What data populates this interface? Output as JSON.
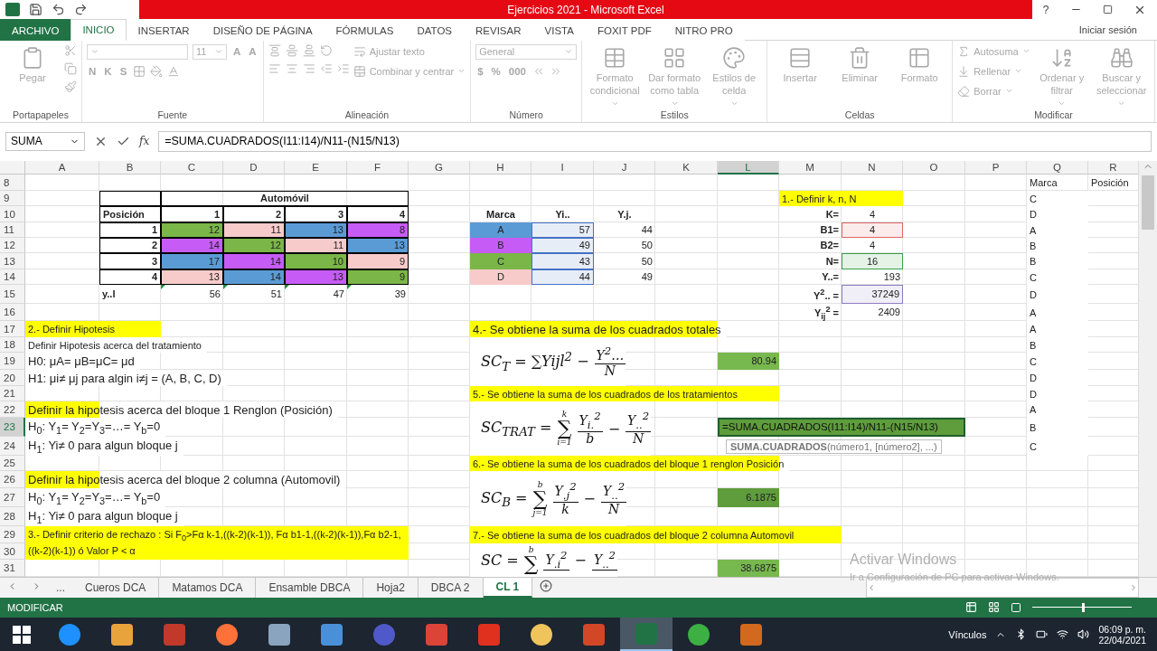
{
  "title_bar": {
    "title": "Ejercicios 2021 -  Microsoft Excel",
    "help": "?"
  },
  "tabs": [
    {
      "label": "ARCHIVO",
      "kind": "file",
      "selected": false
    },
    {
      "label": "INICIO",
      "kind": "tab",
      "selected": true
    },
    {
      "label": "INSERTAR",
      "kind": "tab",
      "selected": false
    },
    {
      "label": "DISEÑO DE PÁGINA",
      "kind": "tab",
      "selected": false
    },
    {
      "label": "FÓRMULAS",
      "kind": "tab",
      "selected": false
    },
    {
      "label": "DATOS",
      "kind": "tab",
      "selected": false
    },
    {
      "label": "REVISAR",
      "kind": "tab",
      "selected": false
    },
    {
      "label": "VISTA",
      "kind": "tab",
      "selected": false
    },
    {
      "label": "FOXIT PDF",
      "kind": "tab",
      "selected": false
    },
    {
      "label": "NITRO PRO",
      "kind": "tab",
      "selected": false
    }
  ],
  "sign_in": "Iniciar sesión",
  "ribbon": {
    "disabled": true,
    "groups": [
      {
        "label": "Portapapeles",
        "columns": [
          [
            {
              "kind": "large",
              "label": "Pegar",
              "menu": false
            }
          ],
          [
            {
              "kind": "icon"
            },
            {
              "kind": "icon"
            },
            {
              "kind": "icon"
            }
          ]
        ]
      },
      {
        "label": "Fuente",
        "columns": [
          [
            {
              "kind": "line",
              "items": [
                {
                  "kind": "wide_field"
                },
                {
                  "kind": "narrow_field",
                  "value": "11"
                },
                {
                  "kind": "glyphs",
                  "glyphs": [
                    "A",
                    "A"
                  ]
                }
              ]
            },
            {
              "kind": "line",
              "items": [
                {
                  "kind": "glyphs",
                  "glyphs": [
                    "N",
                    "K",
                    "S"
                  ]
                },
                {
                  "kind": "icon"
                },
                {
                  "kind": "icon"
                },
                {
                  "kind": "icon"
                }
              ]
            }
          ]
        ]
      },
      {
        "label": "Alineación",
        "columns": [
          [
            {
              "kind": "line",
              "items": [
                {
                  "kind": "icon"
                },
                {
                  "kind": "icon"
                },
                {
                  "kind": "icon"
                },
                {
                  "kind": "icon"
                }
              ]
            },
            {
              "kind": "line",
              "items": [
                {
                  "kind": "icon"
                },
                {
                  "kind": "icon"
                },
                {
                  "kind": "icon"
                },
                {
                  "kind": "icon"
                },
                {
                  "kind": "icon"
                }
              ]
            }
          ],
          [
            {
              "kind": "small",
              "label": "Ajustar texto",
              "menu": false
            },
            {
              "kind": "small",
              "label": "Combinar y centrar",
              "menu": true
            }
          ]
        ]
      },
      {
        "label": "Número",
        "columns": [
          [
            {
              "kind": "wide_field",
              "value": "General"
            },
            {
              "kind": "line",
              "items": [
                {
                  "kind": "glyphs",
                  "glyphs": [
                    "$",
                    "%",
                    "000"
                  ]
                },
                {
                  "kind": "icon"
                },
                {
                  "kind": "icon"
                }
              ]
            }
          ]
        ]
      },
      {
        "label": "Estilos",
        "columns": [
          [
            {
              "kind": "large",
              "label": "Formato condicional",
              "menu": true
            }
          ],
          [
            {
              "kind": "large",
              "label": "Dar formato como tabla",
              "menu": true
            }
          ],
          [
            {
              "kind": "large",
              "label": "Estilos de celda",
              "menu": true
            }
          ]
        ]
      },
      {
        "label": "Celdas",
        "columns": [
          [
            {
              "kind": "large",
              "label": "Insertar",
              "menu": false
            }
          ],
          [
            {
              "kind": "large",
              "label": "Eliminar",
              "menu": false
            }
          ],
          [
            {
              "kind": "large",
              "label": "Formato",
              "menu": false
            }
          ]
        ]
      },
      {
        "label": "Modificar",
        "columns": [
          [
            {
              "kind": "small",
              "label": "Autosuma",
              "menu": true
            },
            {
              "kind": "small",
              "label": "Rellenar",
              "menu": true
            },
            {
              "kind": "small",
              "label": "Borrar",
              "menu": true
            }
          ],
          [
            {
              "kind": "large",
              "label": "Ordenar y filtrar",
              "menu": true
            }
          ],
          [
            {
              "kind": "large",
              "label": "Buscar y seleccionar",
              "menu": true
            }
          ]
        ]
      }
    ]
  },
  "formula_bar": {
    "name_box": "SUMA",
    "fx": "fx",
    "formula": "=SUMA.CUADRADOS(I11:I14)/N11-(N15/N13)"
  },
  "sheet": {
    "columns": [
      {
        "label": "A",
        "selected": false
      },
      {
        "label": "B",
        "selected": false
      },
      {
        "label": "C",
        "selected": false
      },
      {
        "label": "D",
        "selected": false
      },
      {
        "label": "E",
        "selected": false
      },
      {
        "label": "F",
        "selected": false
      },
      {
        "label": "G",
        "selected": false
      },
      {
        "label": "H",
        "selected": false
      },
      {
        "label": "I",
        "selected": false
      },
      {
        "label": "J",
        "selected": false
      },
      {
        "label": "K",
        "selected": false
      },
      {
        "label": "L",
        "selected": true
      },
      {
        "label": "M",
        "selected": false
      },
      {
        "label": "N",
        "selected": false
      },
      {
        "label": "O",
        "selected": false
      },
      {
        "label": "P",
        "selected": false
      },
      {
        "label": "Q",
        "selected": false
      },
      {
        "label": "R",
        "selected": false
      }
    ],
    "rows": [
      {
        "label": "8",
        "selected": false,
        "cells": [
          "",
          "",
          "",
          "",
          "",
          "",
          "",
          "",
          "",
          "",
          "",
          "",
          "",
          "",
          "",
          "",
          {
            "kind": "text",
            "text": "Marca"
          },
          {
            "kind": "text",
            "text": "Posición"
          }
        ]
      },
      {
        "label": "9",
        "selected": false,
        "cells": [
          "",
          {
            "kind": "text",
            "boxed": true
          },
          {
            "kind": "title",
            "text": "Automóvil",
            "boxed": true,
            "colspan": 4
          },
          "",
          "",
          "",
          "",
          "",
          "",
          {
            "kind": "text",
            "text": "1.- Definir k, n, N",
            "color": "#ffff00",
            "colspan": 2
          },
          "",
          "",
          {
            "kind": "text",
            "text": "C"
          }
        ]
      },
      {
        "label": "10",
        "selected": false,
        "cells": [
          "",
          {
            "kind": "bold",
            "text": "Posición",
            "boxed": true
          },
          {
            "kind": "boldnum",
            "text": "1",
            "boxed": true
          },
          {
            "kind": "boldnum",
            "text": "2",
            "boxed": true
          },
          {
            "kind": "boldnum",
            "text": "3",
            "boxed": true
          },
          {
            "kind": "boldnum",
            "text": "4",
            "boxed": true
          },
          "",
          {
            "kind": "title",
            "text": "Marca"
          },
          {
            "kind": "title",
            "text": "Yi.."
          },
          {
            "kind": "title",
            "text": "Y.j."
          },
          "",
          "",
          {
            "kind": "label",
            "text": "K="
          },
          {
            "kind": "center",
            "text": "4"
          },
          "",
          "",
          {
            "kind": "text",
            "text": "D"
          }
        ]
      },
      {
        "label": "11",
        "selected": false,
        "cells": [
          "",
          {
            "kind": "boldnum",
            "text": "1",
            "boxed": true
          },
          {
            "kind": "number",
            "text": "12",
            "boxed": true,
            "color": "#7ab648"
          },
          {
            "kind": "number",
            "text": "11",
            "boxed": true,
            "color": "#f8cbcb"
          },
          {
            "kind": "number",
            "text": "13",
            "boxed": true,
            "color": "#5b9bd5"
          },
          {
            "kind": "number",
            "text": "8",
            "boxed": true,
            "color": "#c65cf5"
          },
          "",
          {
            "kind": "center",
            "text": "A",
            "color": "#5b9bd5"
          },
          {
            "kind": "ref_number",
            "text": "57",
            "color": "#4472c4"
          },
          {
            "kind": "number",
            "text": "44"
          },
          "",
          "",
          {
            "kind": "label",
            "text": "B1="
          },
          {
            "kind": "ref_center",
            "text": "4",
            "color": "#e06666"
          },
          "",
          "",
          {
            "kind": "text",
            "text": "A"
          }
        ]
      },
      {
        "label": "12",
        "selected": false,
        "cells": [
          "",
          {
            "kind": "boldnum",
            "text": "2",
            "boxed": true
          },
          {
            "kind": "number",
            "text": "14",
            "boxed": true,
            "color": "#c65cf5"
          },
          {
            "kind": "number",
            "text": "12",
            "boxed": true,
            "color": "#7ab648"
          },
          {
            "kind": "number",
            "text": "11",
            "boxed": true,
            "color": "#f8cbcb"
          },
          {
            "kind": "number",
            "text": "13",
            "boxed": true,
            "color": "#5b9bd5"
          },
          "",
          {
            "kind": "center",
            "text": "B",
            "color": "#c65cf5"
          },
          {
            "kind": "ref_number",
            "text": "49",
            "color": "#4472c4"
          },
          {
            "kind": "number",
            "text": "50"
          },
          "",
          "",
          {
            "kind": "label",
            "text": "B2="
          },
          {
            "kind": "center",
            "text": "4"
          },
          "",
          "",
          {
            "kind": "text",
            "text": "B"
          }
        ]
      },
      {
        "label": "13",
        "selected": false,
        "cells": [
          "",
          {
            "kind": "boldnum",
            "text": "3",
            "boxed": true
          },
          {
            "kind": "number",
            "text": "17",
            "boxed": true,
            "color": "#5b9bd5"
          },
          {
            "kind": "number",
            "text": "14",
            "boxed": true,
            "color": "#c65cf5"
          },
          {
            "kind": "number",
            "text": "10",
            "boxed": true,
            "color": "#7ab648"
          },
          {
            "kind": "number",
            "text": "9",
            "boxed": true,
            "color": "#f8cbcb"
          },
          "",
          {
            "kind": "center",
            "text": "C",
            "color": "#7ab648"
          },
          {
            "kind": "ref_number",
            "text": "43",
            "color": "#4472c4"
          },
          {
            "kind": "number",
            "text": "50"
          },
          "",
          "",
          {
            "kind": "label",
            "text": "N="
          },
          {
            "kind": "ref_center",
            "text": "16",
            "color": "#38a048"
          },
          "",
          "",
          {
            "kind": "text",
            "text": "B"
          }
        ]
      },
      {
        "label": "14",
        "selected": false,
        "cells": [
          "",
          {
            "kind": "boldnum",
            "text": "4",
            "boxed": true
          },
          {
            "kind": "number",
            "text": "13",
            "boxed": true,
            "color": "#f8cbcb"
          },
          {
            "kind": "number",
            "text": "14",
            "boxed": true,
            "color": "#5b9bd5"
          },
          {
            "kind": "number",
            "text": "13",
            "boxed": true,
            "color": "#c65cf5"
          },
          {
            "kind": "number",
            "text": "9",
            "boxed": true,
            "color": "#7ab648"
          },
          "",
          {
            "kind": "center",
            "text": "D",
            "color": "#f8cbcb"
          },
          {
            "kind": "ref_number",
            "text": "44",
            "color": "#4472c4"
          },
          {
            "kind": "number",
            "text": "49"
          },
          "",
          "",
          {
            "kind": "label",
            "text": "Y..="
          },
          {
            "kind": "number",
            "text": "193"
          },
          "",
          "",
          {
            "kind": "text",
            "text": "C"
          }
        ]
      },
      {
        "label": "15",
        "selected": false,
        "cells": [
          "",
          {
            "kind": "bold",
            "text": "y..l"
          },
          {
            "kind": "number",
            "text": "56",
            "flag": true
          },
          {
            "kind": "number",
            "text": "51",
            "flag": true
          },
          {
            "kind": "number",
            "text": "47",
            "flag": true
          },
          {
            "kind": "number",
            "text": "39",
            "flag": true
          },
          "",
          "",
          "",
          "",
          "",
          "",
          {
            "kind": "label",
            "text": "Y$^{2}$.. ="
          },
          {
            "kind": "ref_number",
            "text": "37249",
            "color": "#8e7cc3"
          },
          "",
          "",
          {
            "kind": "text",
            "text": "D"
          }
        ]
      },
      {
        "label": "16",
        "selected": false,
        "cells": [
          "",
          "",
          "",
          "",
          "",
          "",
          "",
          "",
          "",
          "",
          "",
          "",
          {
            "kind": "label",
            "text": "Y$_{ij}$$^{2}$ ="
          },
          {
            "kind": "number",
            "text": "2409"
          },
          "",
          "",
          {
            "kind": "text",
            "text": "A"
          }
        ]
      },
      {
        "label": "17",
        "selected": false,
        "cells": [
          {
            "kind": "text",
            "text": "2.- Definir Hipotesis",
            "color": "#ffff00",
            "colspan": 2
          },
          "",
          "",
          "",
          "",
          "",
          {
            "kind": "large",
            "text": "4.- Se obtiene la suma de los cuadrados totales",
            "color": "#ffff00",
            "colspan": 4
          },
          "",
          "",
          "",
          "",
          "",
          {
            "kind": "text",
            "text": "A"
          }
        ]
      },
      {
        "label": "18",
        "selected": false,
        "cells": [
          {
            "kind": "text",
            "text": "Definir  Hipotesis acerca del tratamiento"
          },
          "",
          "",
          "",
          "",
          "",
          "",
          "",
          "",
          "",
          "",
          "",
          "",
          "",
          "",
          "",
          {
            "kind": "text",
            "text": "B"
          }
        ]
      },
      {
        "label": "19",
        "selected": false,
        "cells": [
          {
            "kind": "large",
            "text": "H0: μA= μB=μC= μd"
          },
          "",
          "",
          "",
          "",
          "",
          "",
          "",
          "",
          "",
          "",
          {
            "kind": "number",
            "text": "80.94",
            "color": "#77b84f"
          },
          "",
          "",
          "",
          "",
          {
            "kind": "text",
            "text": "C"
          }
        ]
      },
      {
        "label": "20",
        "selected": false,
        "cells": [
          {
            "kind": "large",
            "text": "H1: μi≠ μj para algin i≠j = (A, B, C, D)"
          },
          "",
          "",
          "",
          "",
          "",
          "",
          "",
          "",
          "",
          "",
          "",
          "",
          "",
          "",
          "",
          {
            "kind": "text",
            "text": "D"
          }
        ]
      },
      {
        "label": "21",
        "selected": false,
        "cells": [
          "",
          "",
          "",
          "",
          "",
          "",
          "",
          {
            "kind": "text",
            "text": "5.- Se obtiene la suma de los cuadrados de los tratamientos",
            "color": "#ffff00",
            "colspan": 5
          },
          "",
          "",
          "",
          "",
          {
            "kind": "text",
            "text": "D"
          }
        ]
      },
      {
        "label": "22",
        "selected": false,
        "cells": [
          {
            "kind": "large",
            "text": "Definir la hipotesis acerca del bloque 1 Renglon (Posición)",
            "color": "#ffff00"
          },
          "",
          "",
          "",
          "",
          "",
          "",
          "",
          "",
          "",
          "",
          "",
          "",
          "",
          "",
          "",
          {
            "kind": "text",
            "text": "A"
          }
        ]
      },
      {
        "label": "23",
        "selected": true,
        "cells": [
          {
            "kind": "large",
            "text": "H$_{0}$: Y$_{1}$= Y$_{2}$=Y$_{3}$=…= Y$_{b}$=0"
          },
          "",
          "",
          "",
          "",
          "",
          "",
          "",
          "",
          "",
          "",
          {
            "kind": "formula",
            "color": "#5e9c3c",
            "colspan": 4,
            "text": "=SUMA.CUADRADOS(I11:I14)/N11-(N15/N13)"
          },
          "",
          {
            "kind": "text",
            "text": "B"
          }
        ]
      },
      {
        "label": "24",
        "selected": false,
        "cells": [
          {
            "kind": "large",
            "text": "H$_{1}$: Yi≠ 0 para algun bloque j"
          },
          "",
          "",
          "",
          "",
          "",
          "",
          "",
          "",
          "",
          "",
          "",
          "",
          "",
          "",
          "",
          {
            "kind": "text",
            "text": "C"
          }
        ]
      },
      {
        "label": "25",
        "selected": false,
        "cells": [
          "",
          "",
          "",
          "",
          "",
          "",
          "",
          {
            "kind": "text",
            "text": "6.- Se obtiene la suma de los cuadrados del bloque 1 renglon Posición",
            "color": "#ffff00",
            "colspan": 5
          }
        ]
      },
      {
        "label": "26",
        "selected": false,
        "cells": [
          {
            "kind": "large",
            "text": "Definir la hipotesis acerca del bloque 2 columna (Automovil)",
            "color": "#ffff00"
          }
        ]
      },
      {
        "label": "27",
        "selected": false,
        "cells": [
          {
            "kind": "large",
            "text": "H$_{0}$: Y$_{1}$= Y$_{2}$=Y$_{3}$=…= Y$_{b}$=0"
          },
          "",
          "",
          "",
          "",
          "",
          "",
          "",
          "",
          "",
          "",
          {
            "kind": "number",
            "text": "6.1875",
            "color": "#5e9c3c"
          }
        ]
      },
      {
        "label": "28",
        "selected": false,
        "cells": [
          {
            "kind": "large",
            "text": "H$_{1}$: Yi≠ 0 para algun bloque j"
          }
        ]
      },
      {
        "label": "29",
        "selected": false,
        "cells": [
          {
            "kind": "wrap",
            "text": "3.- Definir criterio de rechazo :  Si  F$_{0}$>Fα k-1,((k-2)(k-1)), Fα b1-1,((k-2)(k-1)),Fα b2-1,((k-2)(k-1))    ó   Valor P < α",
            "color": "#ffff00",
            "colspan": 6,
            "rowspan": 2
          },
          "",
          {
            "kind": "text",
            "text": "7.- Se obtiene la suma de los cuadrados del bloque 2 columna Automovil",
            "color": "#ffff00",
            "colspan": 6
          }
        ]
      },
      {
        "label": "30",
        "selected": false
      },
      {
        "label": "31",
        "selected": false,
        "cells": [
          "",
          "",
          "",
          "",
          "",
          "",
          "",
          "",
          "",
          "",
          "",
          {
            "kind": "number",
            "text": "38.6875",
            "color": "#77b84f"
          }
        ]
      }
    ],
    "equations": [
      {
        "parts": [
          {
            "kind": "text",
            "text": "SC$_{T}$ = ∑Yijl$^{2}$ −"
          },
          {
            "kind": "frac",
            "num": "Y$^{2}$…",
            "den": "N"
          }
        ]
      },
      {
        "parts": [
          {
            "kind": "text",
            "text": "SC$_{TRAT}$ ="
          },
          {
            "kind": "sum",
            "sign": "∑",
            "top": "k",
            "bottom": "i=1"
          },
          {
            "kind": "frac",
            "num": "Y$_{i.}$$^{2}$",
            "den": "b"
          },
          {
            "kind": "text",
            "text": "−"
          },
          {
            "kind": "frac",
            "num": "Y$_{..}$$^{2}$",
            "den": "N"
          }
        ]
      },
      {
        "parts": [
          {
            "kind": "text",
            "text": "SC$_{B}$ ="
          },
          {
            "kind": "sum",
            "sign": "∑",
            "top": "b",
            "bottom": "j=1"
          },
          {
            "kind": "frac",
            "num": "Y$_{.j}$$^{2}$",
            "den": "k"
          },
          {
            "kind": "text",
            "text": "−"
          },
          {
            "kind": "frac",
            "num": "Y$_{..}$$^{2}$",
            "den": "N"
          }
        ]
      },
      {
        "parts": [
          {
            "kind": "text",
            "text": "SC ="
          },
          {
            "kind": "sum",
            "sign": "∑",
            "top": "b"
          },
          {
            "kind": "frac",
            "num": "Y$_{.i}$$^{2}$"
          },
          {
            "kind": "text",
            "text": "−"
          },
          {
            "kind": "frac",
            "num": "Y$_{..}$$^{2}$"
          }
        ]
      }
    ],
    "tooltip": "**SUMA.CUADRADOS**(número1, [número2], ...)"
  },
  "sheet_tabs": {
    "more": "...",
    "tabs": [
      {
        "label": "Cueros DCA",
        "selected": false
      },
      {
        "label": "Matamos DCA",
        "selected": false
      },
      {
        "label": "Ensamble DBCA",
        "selected": false
      },
      {
        "label": "Hoja2",
        "selected": false
      },
      {
        "label": "DBCA 2",
        "selected": false
      },
      {
        "label": "CL 1",
        "selected": true
      }
    ]
  },
  "watermark": {
    "title": "Activar Windows",
    "hint": "Ir a Configuración de PC para activar Windows."
  },
  "status_bar": {
    "mode": "MODIFICAR",
    "zoom": {
      "level": 0.5
    }
  },
  "taskbar": {
    "apps": [
      {
        "selected": false
      },
      {
        "selected": false
      },
      {
        "selected": false
      },
      {
        "selected": false
      },
      {
        "selected": false
      },
      {
        "selected": false
      },
      {
        "selected": false
      },
      {
        "selected": false
      },
      {
        "selected": false
      },
      {
        "selected": false
      },
      {
        "selected": false
      },
      {
        "selected": true
      },
      {
        "selected": false
      },
      {
        "selected": false
      }
    ],
    "links": "Vínculos",
    "time": "06:09 p. m.",
    "date": "22/04/2021"
  }
}
